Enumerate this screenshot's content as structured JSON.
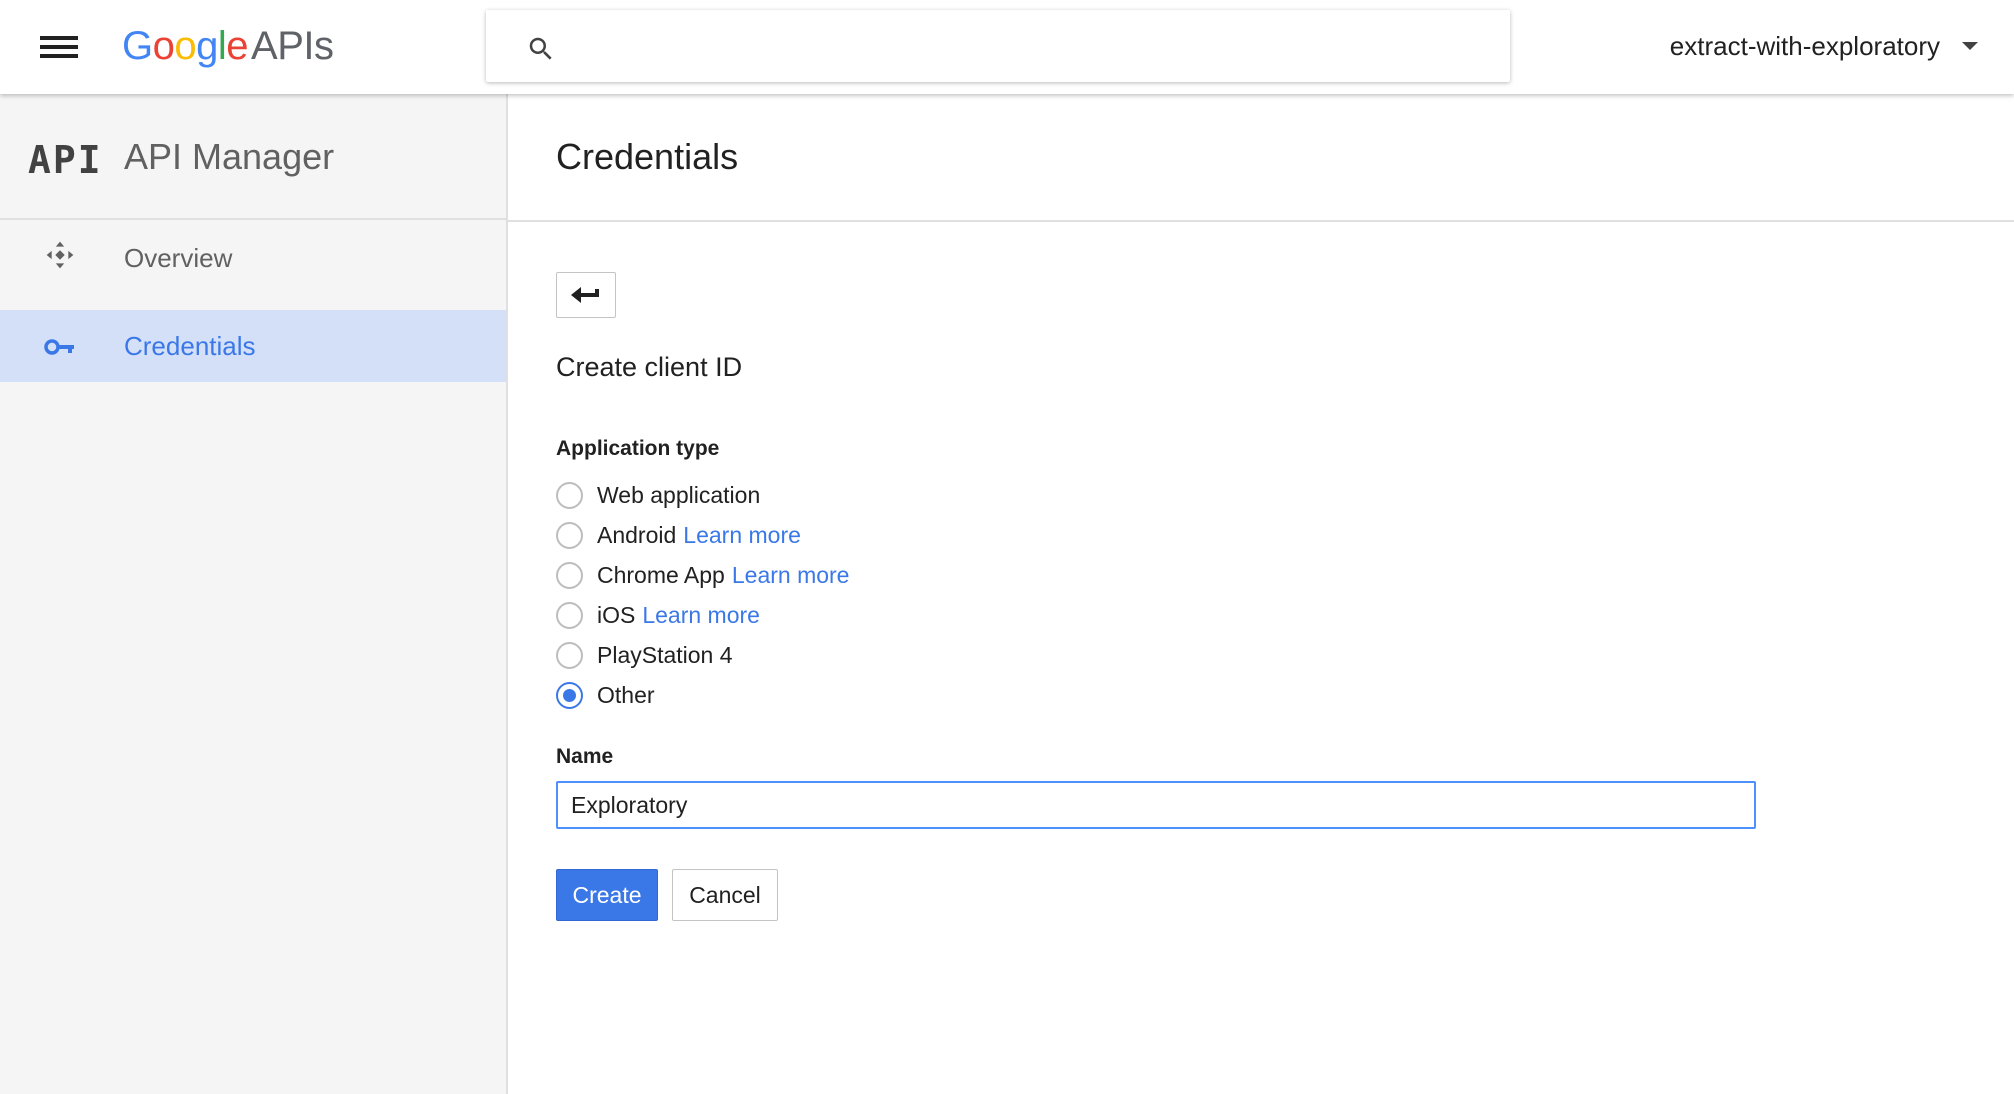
{
  "topbar": {
    "logo_letters": [
      "G",
      "o",
      "o",
      "g",
      "l",
      "e"
    ],
    "logo_suffix": "APIs",
    "brand_colors": {
      "blue": "#4285f4",
      "red": "#ea4335",
      "yellow": "#fbbc05",
      "green": "#34a853"
    },
    "search": {
      "value": "",
      "placeholder": "",
      "icon": "search-icon"
    },
    "project": {
      "label": "extract-with-exploratory",
      "icon": "chevron-down-icon"
    }
  },
  "sidebar": {
    "logo_text": "API",
    "title": "API Manager",
    "items": [
      {
        "label": "Overview",
        "icon": "overview-icon",
        "active": false
      },
      {
        "label": "Credentials",
        "icon": "key-icon",
        "active": true
      }
    ]
  },
  "main": {
    "title": "Credentials",
    "back_icon": "back-arrow-icon",
    "section_title": "Create client ID",
    "application_type_label": "Application type",
    "options": [
      {
        "label": "Web application",
        "link": "",
        "checked": false
      },
      {
        "label": "Android",
        "link": "Learn more",
        "checked": false
      },
      {
        "label": "Chrome App",
        "link": "Learn more",
        "checked": false
      },
      {
        "label": "iOS",
        "link": "Learn more",
        "checked": false
      },
      {
        "label": "PlayStation 4",
        "link": "",
        "checked": false
      },
      {
        "label": "Other",
        "link": "",
        "checked": true
      }
    ],
    "name_label": "Name",
    "name_value": "Exploratory",
    "create_label": "Create",
    "cancel_label": "Cancel"
  },
  "colors": {
    "accent": "#3b78e7",
    "active_nav_bg": "#d4e0f8",
    "sidebar_bg": "#f5f5f5"
  }
}
